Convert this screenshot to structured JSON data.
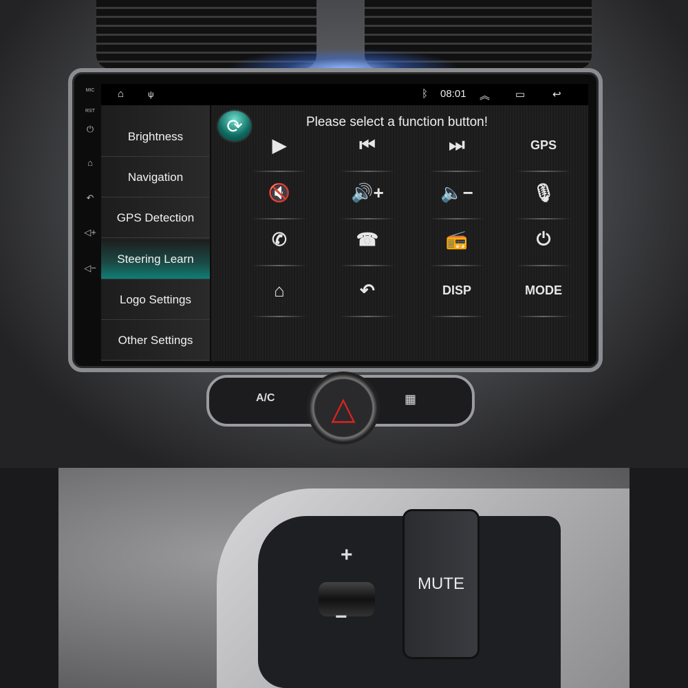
{
  "bezel_keys": [
    "MIC",
    "RST",
    "power-icon",
    "home-icon",
    "back-icon",
    "volume-up-icon",
    "volume-down-icon"
  ],
  "status": {
    "time": "08:01",
    "icons": [
      "home-icon",
      "usb-icon",
      "bluetooth-icon",
      "chevron-up-icon",
      "recent-apps-icon",
      "back-icon"
    ]
  },
  "sidebar": {
    "items": [
      {
        "label": "Brightness"
      },
      {
        "label": "Navigation"
      },
      {
        "label": "GPS Detection"
      },
      {
        "label": "Steering Learn",
        "active": true
      },
      {
        "label": "Logo Settings"
      },
      {
        "label": "Other Settings"
      }
    ]
  },
  "main": {
    "prompt": "Please select a function button!",
    "grid": [
      {
        "icon": "play-icon",
        "glyph": "▶"
      },
      {
        "icon": "previous-track-icon",
        "glyph": "⏮"
      },
      {
        "icon": "next-track-icon",
        "glyph": "⏭"
      },
      {
        "label": "GPS"
      },
      {
        "icon": "mute-icon",
        "glyph": "🔇"
      },
      {
        "icon": "volume-up-icon",
        "glyph": "🔊+"
      },
      {
        "icon": "volume-down-icon",
        "glyph": "🔈−"
      },
      {
        "icon": "microphone-icon",
        "glyph": "🎙"
      },
      {
        "icon": "phone-answer-icon",
        "glyph": "✆"
      },
      {
        "icon": "phone-hangup-icon",
        "glyph": "☎"
      },
      {
        "icon": "radio-icon",
        "glyph": "📻"
      },
      {
        "icon": "power-icon",
        "glyph": "⏻"
      },
      {
        "icon": "home-icon",
        "glyph": "⌂"
      },
      {
        "icon": "back-icon",
        "glyph": "↶"
      },
      {
        "label": "DISP"
      },
      {
        "label": "MODE"
      }
    ]
  },
  "console": {
    "ac_label": "A/C",
    "hazard_icon": "hazard-icon",
    "defrost_icon": "rear-defrost-icon"
  },
  "steering": {
    "plus": "+",
    "minus": "−",
    "mute": "MUTE"
  },
  "colors": {
    "active_item": "#0f7f74",
    "screen_bg": "#1b1b1c"
  }
}
